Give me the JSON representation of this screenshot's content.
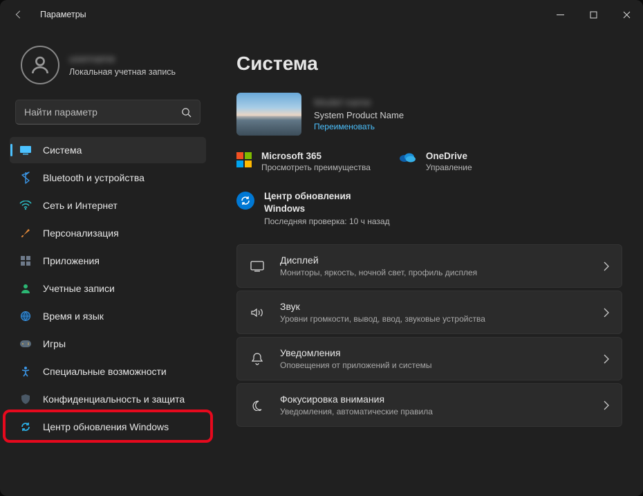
{
  "titlebar": {
    "title": "Параметры"
  },
  "account": {
    "name": "username",
    "sub": "Локальная учетная запись"
  },
  "search": {
    "placeholder": "Найти параметр"
  },
  "nav": [
    {
      "id": "system",
      "label": "Система",
      "selected": true
    },
    {
      "id": "bluetooth",
      "label": "Bluetooth и устройства"
    },
    {
      "id": "network",
      "label": "Сеть и Интернет"
    },
    {
      "id": "personalization",
      "label": "Персонализация"
    },
    {
      "id": "apps",
      "label": "Приложения"
    },
    {
      "id": "accounts",
      "label": "Учетные записи"
    },
    {
      "id": "time",
      "label": "Время и язык"
    },
    {
      "id": "gaming",
      "label": "Игры"
    },
    {
      "id": "accessibility",
      "label": "Специальные возможности"
    },
    {
      "id": "privacy",
      "label": "Конфиденциальность и защита"
    },
    {
      "id": "update",
      "label": "Центр обновления Windows",
      "highlighted": true
    }
  ],
  "main": {
    "heading": "Система",
    "device": {
      "model": "Model name",
      "product": "System Product Name",
      "rename": "Переименовать"
    },
    "ms365": {
      "label": "Microsoft 365",
      "sub": "Просмотреть преимущества"
    },
    "onedrive": {
      "label": "OneDrive",
      "sub": "Управление"
    },
    "wu": {
      "label": "Центр обновления Windows",
      "sub": "Последняя проверка: 10 ч назад"
    },
    "cards": [
      {
        "id": "display",
        "title": "Дисплей",
        "sub": "Мониторы, яркость, ночной свет, профиль дисплея"
      },
      {
        "id": "sound",
        "title": "Звук",
        "sub": "Уровни громкости, вывод, ввод, звуковые устройства"
      },
      {
        "id": "notifications",
        "title": "Уведомления",
        "sub": "Оповещения от приложений и системы"
      },
      {
        "id": "focus",
        "title": "Фокусировка внимания",
        "sub": "Уведомления, автоматические правила"
      }
    ]
  }
}
